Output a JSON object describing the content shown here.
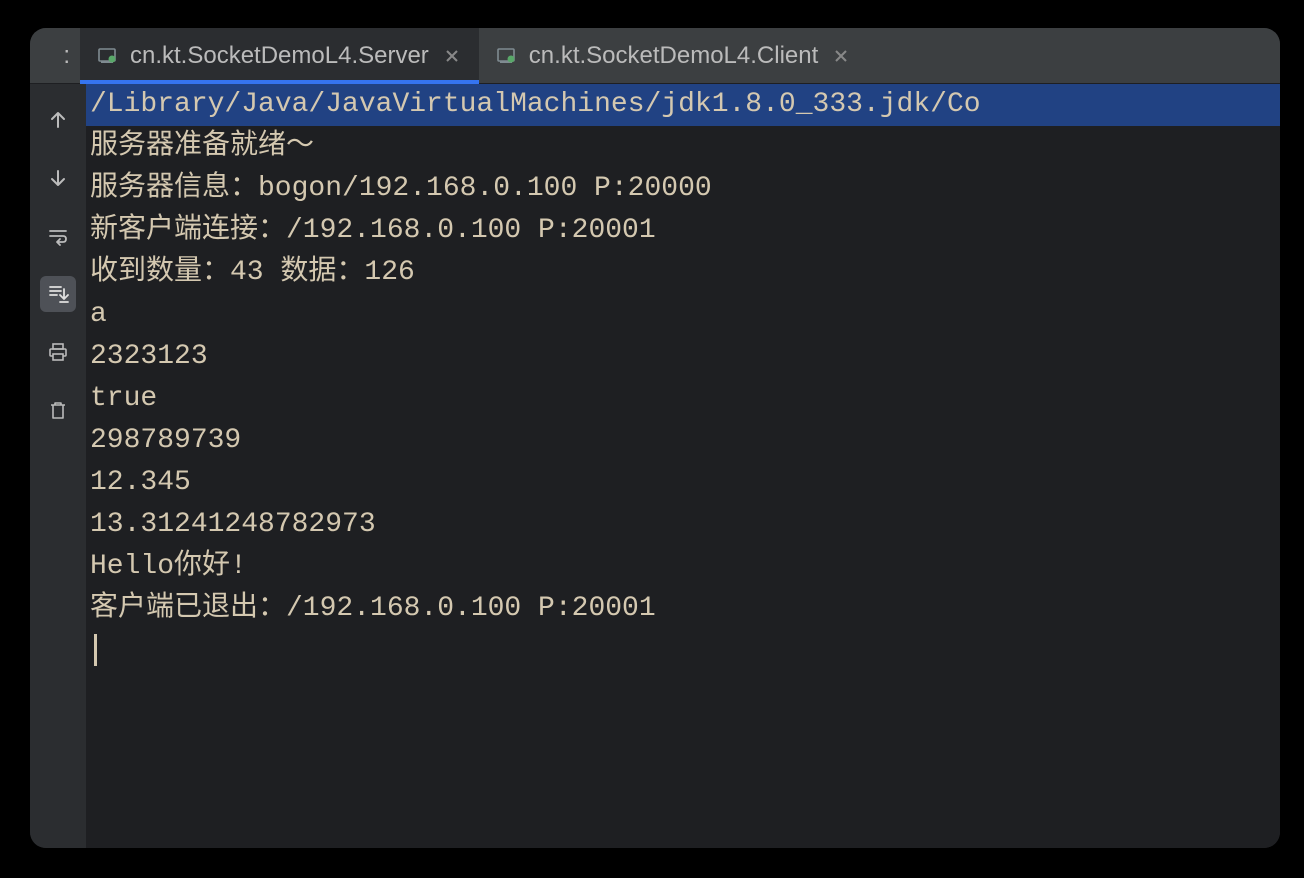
{
  "tabs": [
    {
      "label": "cn.kt.SocketDemoL4.Server",
      "active": true
    },
    {
      "label": "cn.kt.SocketDemoL4.Client",
      "active": false
    }
  ],
  "leftLabel": ":",
  "console": {
    "pathLine": "/Library/Java/JavaVirtualMachines/jdk1.8.0_333.jdk/Co",
    "lines": [
      "服务器准备就绪～",
      "服务器信息：bogon/192.168.0.100 P:20000",
      "新客户端连接：/192.168.0.100 P:20001",
      "收到数量：43 数据：126",
      "a",
      "2323123",
      "true",
      "298789739",
      "12.345",
      "13.31241248782973",
      "Hello你好!",
      "",
      "客户端已退出：/192.168.0.100 P:20001"
    ]
  },
  "gutterIcons": [
    "up-arrow-icon",
    "down-arrow-icon",
    "soft-wrap-icon",
    "scroll-to-end-icon",
    "print-icon",
    "trash-icon"
  ]
}
